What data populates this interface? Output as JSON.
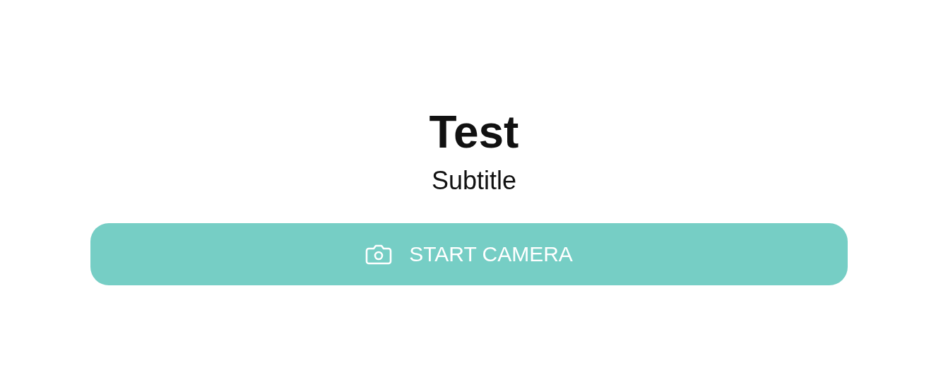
{
  "title": "Test",
  "subtitle": "Subtitle",
  "button": {
    "label": "START CAMERA"
  }
}
